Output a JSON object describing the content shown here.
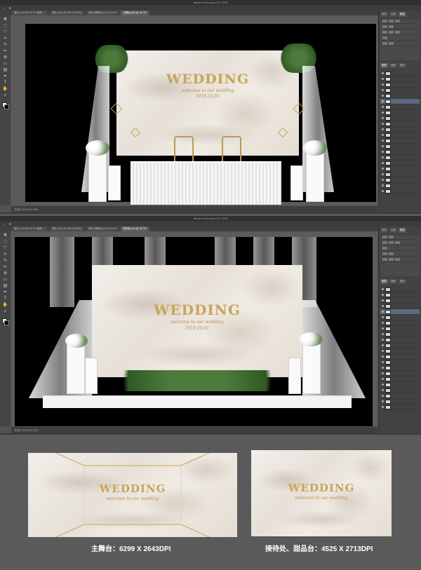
{
  "window1": {
    "title": "Adobe Photoshop CC 2018",
    "tabs": [
      "婚礼1.psd @ 16.7% (图层...)",
      "婚礼2.psd @ 25% (RGB/8)",
      "婚礼效果图.psd @ 12.5%",
      "主舞台.psd @ 16.7%"
    ],
    "active_tab": 3,
    "status": "文档:126.7M/2.36G",
    "wedding": "WEDDING",
    "subtitle": "welcome to our wedding",
    "date": "2019.10.01"
  },
  "window2": {
    "title": "Adobe Photoshop CC 2018",
    "tabs": [
      "婚礼1.psd @ 16.7% (图层...)",
      "婚礼2.psd @ 25% (RGB/8)",
      "婚礼效果图.psd @ 12.5%",
      "签到区.psd @ 16.7%"
    ],
    "active_tab": 3,
    "status": "文档:126.7M/2.36G",
    "wedding": "WEDDING",
    "subtitle": "welcome to our wedding",
    "date": "2019.10.01"
  },
  "panel": {
    "tabs": [
      "颜色",
      "色板",
      "属性"
    ],
    "layer_tabs": [
      "图层",
      "通道",
      "路径"
    ]
  },
  "previews": {
    "main": {
      "wedding": "WEDDING",
      "subtitle": "welcome to our wedding",
      "caption": "主舞台：6299 X 2643DPI"
    },
    "reception": {
      "wedding": "WEDDING",
      "subtitle": "welcome to our wedding",
      "caption": "接待处、甜品台：4525 X 2713DPI"
    }
  },
  "colors": {
    "gold": "#c9a45a",
    "marble": "#ece6de",
    "canvas": "#000000",
    "ui": "#535353"
  }
}
